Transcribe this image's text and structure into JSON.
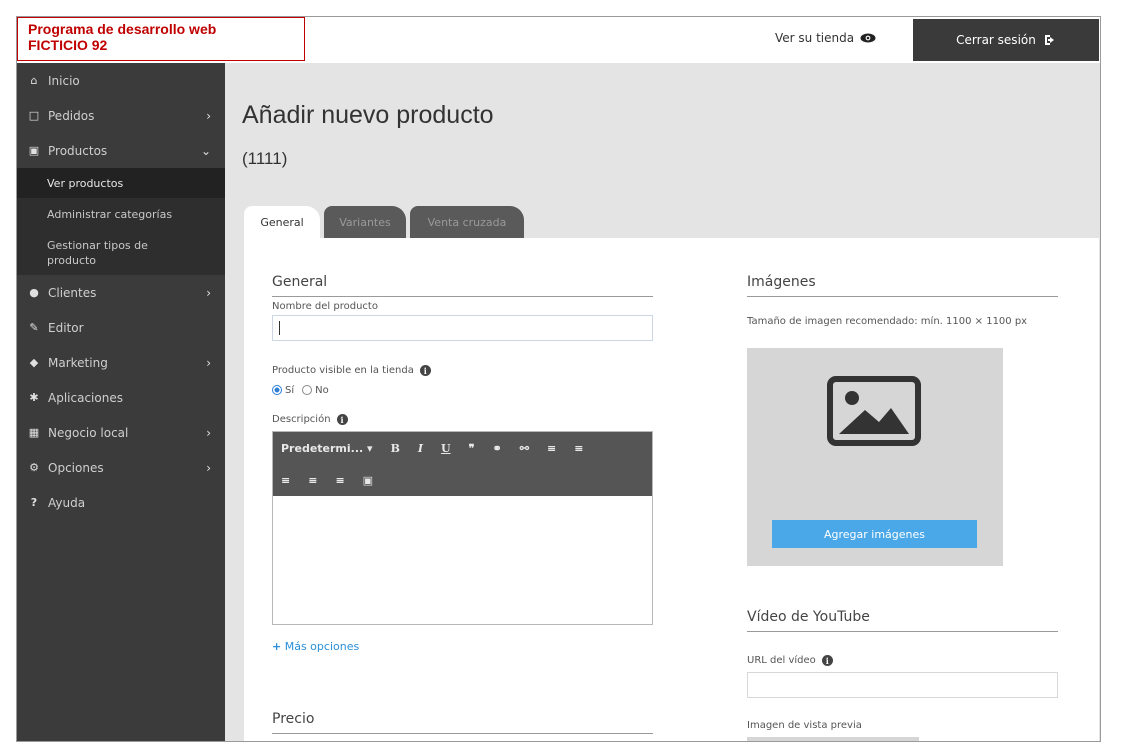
{
  "brand": {
    "line1": "Programa de desarrollo web",
    "line2": "FICTICIO 92"
  },
  "header": {
    "view_store": "Ver su tienda",
    "logout": "Cerrar sesión"
  },
  "sidebar": {
    "items": [
      {
        "label": "Inicio",
        "icon": "home-icon"
      },
      {
        "label": "Pedidos",
        "icon": "orders-icon"
      },
      {
        "label": "Productos",
        "icon": "cart-icon"
      },
      {
        "label": "Clientes",
        "icon": "users-icon"
      },
      {
        "label": "Editor",
        "icon": "pencil-icon"
      },
      {
        "label": "Marketing",
        "icon": "tag-icon"
      },
      {
        "label": "Aplicaciones",
        "icon": "puzzle-icon"
      },
      {
        "label": "Negocio local",
        "icon": "store-icon"
      },
      {
        "label": "Opciones",
        "icon": "gear-icon"
      },
      {
        "label": "Ayuda",
        "icon": "help-icon"
      }
    ],
    "subitems": [
      "Ver productos",
      "Administrar categorías",
      "Gestionar tipos de producto"
    ]
  },
  "main": {
    "title": "Añadir nuevo producto",
    "count": "(1111)"
  },
  "tabs": [
    "General",
    "Variantes",
    "Venta cruzada"
  ],
  "general": {
    "section_title": "General",
    "name_label": "Nombre del producto",
    "visible_label": "Producto visible en la tienda",
    "radio_yes": "Sí",
    "radio_no": "No",
    "description_label": "Descripción",
    "editor_format": "Predetermi...",
    "more_options": "Más opciones"
  },
  "price": {
    "section_title": "Precio"
  },
  "images": {
    "section_title": "Imágenes",
    "recommended": "Tamaño de imagen recomendado: mín. 1100 × 1100 px",
    "add_button": "Agregar imágenes"
  },
  "youtube": {
    "section_title": "Vídeo de YouTube",
    "url_label": "URL del vídeo",
    "preview_label": "Imagen de vista previa"
  },
  "colors": {
    "accent": "#4aa8e8",
    "brand_red": "#c00000",
    "sidebar_bg": "#3b3b3b"
  }
}
